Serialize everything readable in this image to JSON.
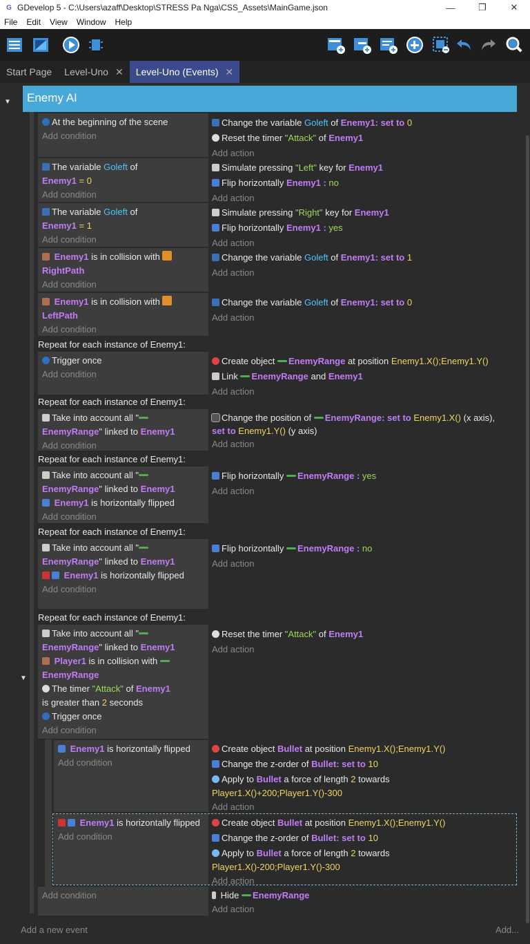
{
  "window": {
    "title": "GDevelop 5 - C:\\Users\\azaff\\Desktop\\STRESS Pa Nga\\CSS_Assets\\MainGame.json",
    "min": "—",
    "max": "❐",
    "close": "✕"
  },
  "menu": [
    "File",
    "Edit",
    "View",
    "Window",
    "Help"
  ],
  "tabs": [
    {
      "label": "Start Page"
    },
    {
      "label": "Level-Uno",
      "close": "✕"
    },
    {
      "label": "Level-Uno (Events)",
      "close": "✕"
    }
  ],
  "group": "Enemy AI",
  "add_condition": "Add condition",
  "add_action": "Add action",
  "footer": {
    "add_event": "Add a new event",
    "add": "Add..."
  },
  "repeat_label": "Repeat for each instance of Enemy1:",
  "e1": {
    "c1": "At the beginning of the scene",
    "a1": "Change the variable",
    "a1v": "Goleft",
    "a1of": "of",
    "a1o": "Enemy1",
    "a1set": ": set to",
    "a1n": "0",
    "a2": "Reset the timer",
    "a2s": "\"Attack\"",
    "a2of": "of",
    "a2o": "Enemy1"
  },
  "e2": {
    "c1": "The variable",
    "c1v": "Goleft",
    "c1of": "of",
    "c1o": "Enemy1",
    "c1eq": "=",
    "c1n": "0",
    "a1": "Simulate pressing",
    "a1s": "\"Left\"",
    "a1k": "key for",
    "a1o": "Enemy1",
    "a2": "Flip horizontally",
    "a2o": "Enemy1",
    "a2c": ":",
    "a2v": "no"
  },
  "e3": {
    "c1": "The variable",
    "c1v": "Goleft",
    "c1of": "of",
    "c1o": "Enemy1",
    "c1eq": "=",
    "c1n": "1",
    "a1": "Simulate pressing",
    "a1s": "\"Right\"",
    "a1k": "key for",
    "a1o": "Enemy1",
    "a2": "Flip horizontally",
    "a2o": "Enemy1",
    "a2c": ":",
    "a2v": "yes"
  },
  "e4": {
    "c1o": "Enemy1",
    "c1": "is in collision with",
    "c1t": "RightPath",
    "a1": "Change the variable",
    "a1v": "Goleft",
    "a1of": "of",
    "a1o": "Enemy1",
    "a1set": ": set to",
    "a1n": "1"
  },
  "e5": {
    "c1o": "Enemy1",
    "c1": "is in collision with",
    "c1t": "LeftPath",
    "a1": "Change the variable",
    "a1v": "Goleft",
    "a1of": "of",
    "a1o": "Enemy1",
    "a1set": ": set to",
    "a1n": "0"
  },
  "e6": {
    "c1": "Trigger once",
    "a1": "Create object",
    "a1o": "EnemyRange",
    "a1p": "at position",
    "a1n": "Enemy1.X();Enemy1.Y()",
    "a2": "Link",
    "a2o": "EnemyRange",
    "a2and": "and",
    "a2o2": "Enemy1"
  },
  "e7": {
    "c1": "Take into account all \"",
    "c1o": "EnemyRange",
    "c1l": "\" linked to",
    "c1o2": "Enemy1",
    "a1": "Change the position of",
    "a1o": "EnemyRange",
    "a1set": ": set to",
    "a1n": "Enemy1.X()",
    "a1x": "(x axis),",
    "a1set2": "set to",
    "a1n2": "Enemy1.Y()",
    "a1y": "(y axis)"
  },
  "e8": {
    "c1": "Take into account all \"",
    "c1o": "EnemyRange",
    "c1l": "\" linked to",
    "c1o2": "Enemy1",
    "c2o": "Enemy1",
    "c2": "is horizontally flipped",
    "a1": "Flip horizontally",
    "a1o": "EnemyRange",
    "a1c": ":",
    "a1v": "yes"
  },
  "e9": {
    "c1": "Take into account all \"",
    "c1o": "EnemyRange",
    "c1l": "\" linked to",
    "c1o2": "Enemy1",
    "c2o": "Enemy1",
    "c2": "is horizontally flipped",
    "a1": "Flip horizontally",
    "a1o": "EnemyRange",
    "a1c": ":",
    "a1v": "no"
  },
  "e10": {
    "c1": "Take into account all \"",
    "c1o": "EnemyRange",
    "c1l": "\" linked to",
    "c1o2": "Enemy1",
    "c2o": "Player1",
    "c2": "is in collision with",
    "c2t": "EnemyRange",
    "c3": "The timer",
    "c3s": "\"Attack\"",
    "c3of": "of",
    "c3o": "Enemy1",
    "c3g": "is greater than",
    "c3n": "2",
    "c3u": "seconds",
    "c4": "Trigger once",
    "a1": "Reset the timer",
    "a1s": "\"Attack\"",
    "a1of": "of",
    "a1o": "Enemy1"
  },
  "s1": {
    "c1o": "Enemy1",
    "c1": "is horizontally flipped",
    "a1": "Create object",
    "a1o": "Bullet",
    "a1p": "at position",
    "a1n": "Enemy1.X();Enemy1.Y()",
    "a2": "Change the z-order of",
    "a2o": "Bullet",
    "a2set": ": set to",
    "a2n": "10",
    "a3": "Apply to",
    "a3o": "Bullet",
    "a3f": "a force of length",
    "a3n": "2",
    "a3t": "towards",
    "a3e": "Player1.X()+200;Player1.Y()-300"
  },
  "s2": {
    "c1o": "Enemy1",
    "c1": "is horizontally flipped",
    "a1": "Create object",
    "a1o": "Bullet",
    "a1p": "at position",
    "a1n": "Enemy1.X();Enemy1.Y()",
    "a2": "Change the z-order of",
    "a2o": "Bullet",
    "a2set": ": set to",
    "a2n": "10",
    "a3": "Apply to",
    "a3o": "Bullet",
    "a3f": "a force of length",
    "a3n": "2",
    "a3t": "towards",
    "a3e": "Player1.X()-200;Player1.Y()-300"
  },
  "s3": {
    "a1": "Hide",
    "a1o": "EnemyRange"
  }
}
